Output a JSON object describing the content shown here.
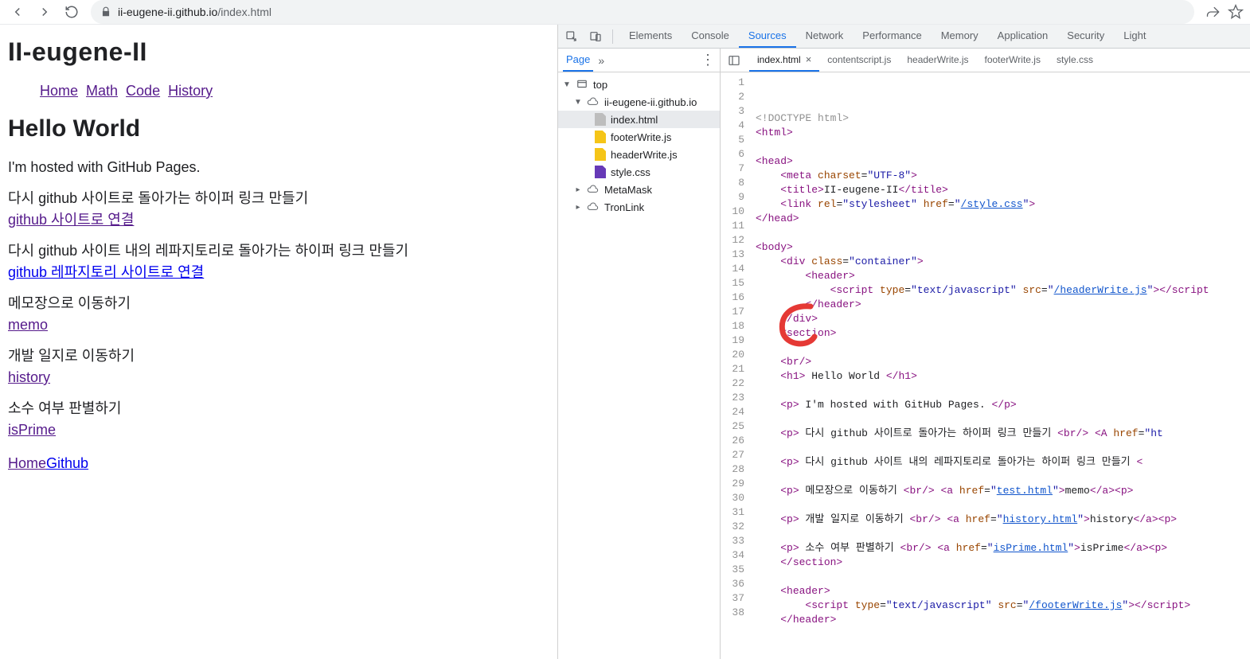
{
  "browser": {
    "url_host": "ii-eugene-ii.github.io",
    "url_path": "/index.html"
  },
  "page": {
    "site_title": "II-eugene-II",
    "nav": [
      "Home",
      "Math",
      "Code",
      "History"
    ],
    "hello": "Hello World",
    "hosted": "I'm hosted with GitHub Pages.",
    "sections": [
      {
        "text": "다시 github 사이트로 돌아가는 하이퍼 링크 만들기",
        "link": "github 사이트로 연결",
        "purple": true
      },
      {
        "text": "다시 github 사이트 내의 레파지토리로 돌아가는 하이퍼 링크 만들기",
        "link": "github 레파지토리 사이트로 연결",
        "purple": false
      },
      {
        "text": "메모장으로 이동하기",
        "link": "memo",
        "purple": true
      },
      {
        "text": "개발 일지로 이동하기",
        "link": "history",
        "purple": true
      },
      {
        "text": "소수 여부 판별하기",
        "link": "isPrime",
        "purple": true
      }
    ],
    "footer": {
      "home": "Home",
      "github": "Github"
    }
  },
  "devtools": {
    "tabs": [
      "Elements",
      "Console",
      "Sources",
      "Network",
      "Performance",
      "Memory",
      "Application",
      "Security",
      "Light"
    ],
    "active_tab": "Sources",
    "navigator": {
      "tab": "Page",
      "tree": {
        "top": "top",
        "domain": "ii-eugene-ii.github.io",
        "files": [
          {
            "name": "index.html",
            "type": "html",
            "selected": true
          },
          {
            "name": "footerWrite.js",
            "type": "js"
          },
          {
            "name": "headerWrite.js",
            "type": "js"
          },
          {
            "name": "style.css",
            "type": "css"
          }
        ],
        "ext": [
          "MetaMask",
          "TronLink"
        ]
      }
    },
    "editor_tabs": [
      {
        "name": "index.html",
        "active": true,
        "closable": true
      },
      {
        "name": "contentscript.js"
      },
      {
        "name": "headerWrite.js"
      },
      {
        "name": "footerWrite.js"
      },
      {
        "name": "style.css"
      }
    ],
    "code_lines": [
      {
        "n": 1,
        "html": "<span class='tok-doctype'>&lt;!DOCTYPE html&gt;</span>"
      },
      {
        "n": 2,
        "html": "<span class='tok-tag'>&lt;html&gt;</span>"
      },
      {
        "n": 3,
        "html": ""
      },
      {
        "n": 4,
        "html": "<span class='tok-tag'>&lt;head&gt;</span>"
      },
      {
        "n": 5,
        "html": "    <span class='tok-tag'>&lt;meta</span> <span class='tok-attr'>charset</span>=<span class='tok-str'>\"UTF-8\"</span><span class='tok-tag'>&gt;</span>"
      },
      {
        "n": 6,
        "html": "    <span class='tok-tag'>&lt;title&gt;</span>II-eugene-II<span class='tok-tag'>&lt;/title&gt;</span>"
      },
      {
        "n": 7,
        "html": "    <span class='tok-tag'>&lt;link</span> <span class='tok-attr'>rel</span>=<span class='tok-str'>\"stylesheet\"</span> <span class='tok-attr'>href</span>=<span class='tok-str'>\"</span><span class='tok-link'>/style.css</span><span class='tok-str'>\"</span><span class='tok-tag'>&gt;</span>"
      },
      {
        "n": 8,
        "html": "<span class='tok-tag'>&lt;/head&gt;</span>"
      },
      {
        "n": 9,
        "html": ""
      },
      {
        "n": 10,
        "html": "<span class='tok-tag'>&lt;body&gt;</span>"
      },
      {
        "n": 11,
        "html": "    <span class='tok-tag'>&lt;div</span> <span class='tok-attr'>class</span>=<span class='tok-str'>\"container\"</span><span class='tok-tag'>&gt;</span>"
      },
      {
        "n": 12,
        "html": "        <span class='tok-tag'>&lt;header&gt;</span>"
      },
      {
        "n": 13,
        "html": "            <span class='tok-tag'>&lt;script</span> <span class='tok-attr'>type</span>=<span class='tok-str'>\"text/javascript\"</span> <span class='tok-attr'>src</span>=<span class='tok-str'>\"</span><span class='tok-link'>/headerWrite.js</span><span class='tok-str'>\"</span><span class='tok-tag'>&gt;&lt;/script</span>"
      },
      {
        "n": 14,
        "html": "        <span class='tok-tag'>&lt;/header&gt;</span>"
      },
      {
        "n": 15,
        "html": "    <span class='tok-tag'>&lt;/div&gt;</span>"
      },
      {
        "n": 16,
        "html": "    <span class='tok-tag'>&lt;section&gt;</span>"
      },
      {
        "n": 17,
        "html": ""
      },
      {
        "n": 18,
        "html": "    <span class='tok-tag'>&lt;br/&gt;</span>"
      },
      {
        "n": 19,
        "html": "    <span class='tok-tag'>&lt;h1&gt;</span> Hello World <span class='tok-tag'>&lt;/h1&gt;</span>"
      },
      {
        "n": 20,
        "html": ""
      },
      {
        "n": 21,
        "html": "    <span class='tok-tag'>&lt;p&gt;</span> I'm hosted with GitHub Pages. <span class='tok-tag'>&lt;/p&gt;</span>"
      },
      {
        "n": 22,
        "html": ""
      },
      {
        "n": 23,
        "html": "    <span class='tok-tag'>&lt;p&gt;</span> 다시 github 사이트로 돌아가는 하이퍼 링크 만들기 <span class='tok-tag'>&lt;br/&gt;</span> <span class='tok-tag'>&lt;A</span> <span class='tok-attr'>href</span>=<span class='tok-str'>\"ht</span>"
      },
      {
        "n": 24,
        "html": ""
      },
      {
        "n": 25,
        "html": "    <span class='tok-tag'>&lt;p&gt;</span> 다시 github 사이트 내의 레파지토리로 돌아가는 하이퍼 링크 만들기 <span class='tok-tag'>&lt;</span>"
      },
      {
        "n": 26,
        "html": ""
      },
      {
        "n": 27,
        "html": "    <span class='tok-tag'>&lt;p&gt;</span> 메모장으로 이동하기 <span class='tok-tag'>&lt;br/&gt;</span> <span class='tok-tag'>&lt;a</span> <span class='tok-attr'>href</span>=<span class='tok-str'>\"</span><span class='tok-link'>test.html</span><span class='tok-str'>\"</span><span class='tok-tag'>&gt;</span>memo<span class='tok-tag'>&lt;/a&gt;&lt;p&gt;</span>"
      },
      {
        "n": 28,
        "html": ""
      },
      {
        "n": 29,
        "html": "    <span class='tok-tag'>&lt;p&gt;</span> 개발 일지로 이동하기 <span class='tok-tag'>&lt;br/&gt;</span> <span class='tok-tag'>&lt;a</span> <span class='tok-attr'>href</span>=<span class='tok-str'>\"</span><span class='tok-link'>history.html</span><span class='tok-str'>\"</span><span class='tok-tag'>&gt;</span>history<span class='tok-tag'>&lt;/a&gt;&lt;p&gt;</span>"
      },
      {
        "n": 30,
        "html": ""
      },
      {
        "n": 31,
        "html": "    <span class='tok-tag'>&lt;p&gt;</span> 소수 여부 판별하기 <span class='tok-tag'>&lt;br/&gt;</span> <span class='tok-tag'>&lt;a</span> <span class='tok-attr'>href</span>=<span class='tok-str'>\"</span><span class='tok-link'>isPrime.html</span><span class='tok-str'>\"</span><span class='tok-tag'>&gt;</span>isPrime<span class='tok-tag'>&lt;/a&gt;&lt;p&gt;</span>"
      },
      {
        "n": 32,
        "html": "    <span class='tok-tag'>&lt;/section&gt;</span>"
      },
      {
        "n": 33,
        "html": ""
      },
      {
        "n": 34,
        "html": "    <span class='tok-tag'>&lt;header&gt;</span>"
      },
      {
        "n": 35,
        "html": "        <span class='tok-tag'>&lt;script</span> <span class='tok-attr'>type</span>=<span class='tok-str'>\"text/javascript\"</span> <span class='tok-attr'>src</span>=<span class='tok-str'>\"</span><span class='tok-link'>/footerWrite.js</span><span class='tok-str'>\"</span><span class='tok-tag'>&gt;&lt;/script&gt;</span>"
      },
      {
        "n": 36,
        "html": "    <span class='tok-tag'>&lt;/header&gt;</span>"
      },
      {
        "n": 37,
        "html": ""
      },
      {
        "n": 38,
        "html": ""
      }
    ]
  }
}
